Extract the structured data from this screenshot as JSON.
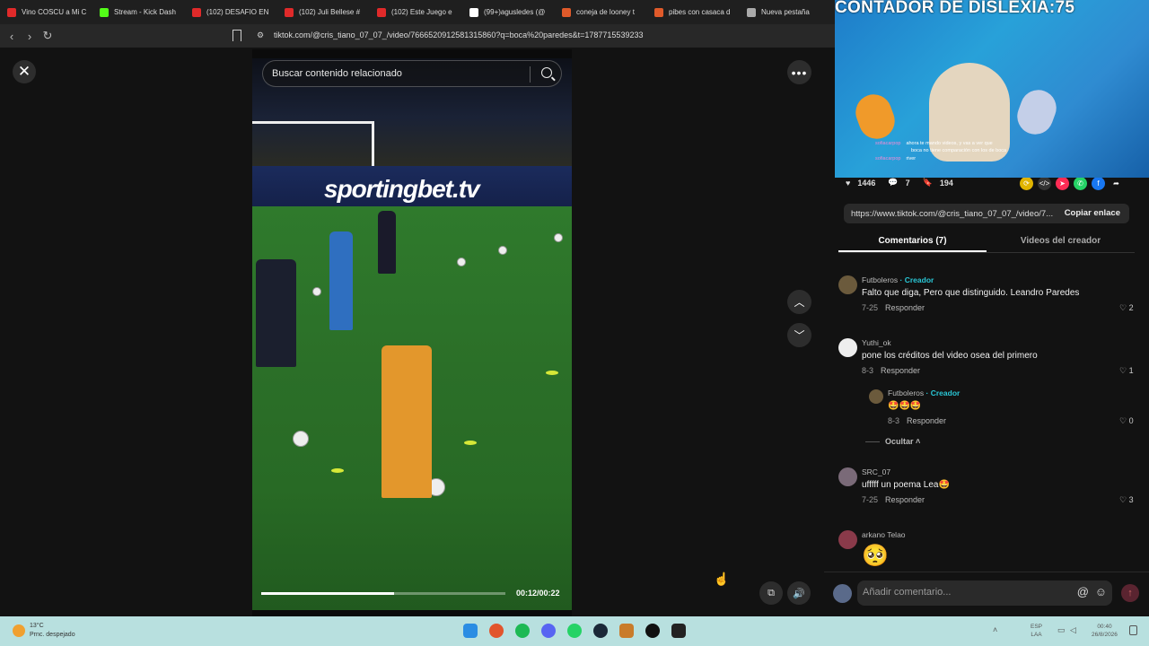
{
  "browser": {
    "tabs": [
      {
        "label": "Vino COSCU a Mi C",
        "color": "#e02a2a"
      },
      {
        "label": "Stream - Kick Dash",
        "color": "#53fc18"
      },
      {
        "label": "(102) DESAFIO EN",
        "color": "#e02a2a"
      },
      {
        "label": "(102) Juli Bellese #",
        "color": "#e02a2a"
      },
      {
        "label": "(102) Este Juego e",
        "color": "#e02a2a"
      },
      {
        "label": "(99+)agusledes (@",
        "color": "#ffffff"
      },
      {
        "label": "coneja de looney t",
        "color": "#e05a2a"
      },
      {
        "label": "pibes con casaca d",
        "color": "#e05a2a"
      },
      {
        "label": "Nueva pestaña",
        "color": "#aaaaaa"
      }
    ],
    "url": "tiktok.com/@cris_tiano_07_07_/video/7666520912581315860?q=boca%20paredes&t=1787715539233"
  },
  "video": {
    "search_placeholder": "Buscar contenido relacionado",
    "ad_text": "sportingbet.tv",
    "time": "00:12/00:22",
    "progress": 0.545
  },
  "stream_overlay": {
    "counter": "CONTADOR DE DISLEXIA:75",
    "chat": [
      {
        "user": "sofiacarpop",
        "text": "ahora te mando videos, y vas a ver que"
      },
      {
        "user": "",
        "text": "boca no tiene comparación con los de boca"
      },
      {
        "user": "sofiacarpop",
        "text": "river"
      }
    ]
  },
  "stats": {
    "likes": "1446",
    "comments": "7",
    "saves": "194"
  },
  "share": {
    "link": "https://www.tiktok.com/@cris_tiano_07_07_/video/7...",
    "copy_label": "Copiar enlace"
  },
  "tabs": {
    "comments": "Comentarios (7)",
    "creator_videos": "Videos del creador"
  },
  "comments": [
    {
      "user": "Futboleros",
      "badge": "· Creador",
      "text": "Falto que diga, Pero que distinguido. Leandro Paredes",
      "date": "7-25",
      "reply": "Responder",
      "likes": "2"
    },
    {
      "user": "Yuthi_ok",
      "badge": "",
      "text": "pone los créditos del video osea del primero",
      "date": "8-3",
      "reply": "Responder",
      "likes": "1"
    },
    {
      "user": "Futboleros",
      "badge": "· Creador",
      "text": "🤩🤩🤩",
      "date": "8-3",
      "reply": "Responder",
      "likes": "0"
    },
    {
      "user": "SRC_07",
      "badge": "",
      "text": "ufffff un poema Lea🤩",
      "date": "7-25",
      "reply": "Responder",
      "likes": "3"
    },
    {
      "user": "arkano Telao",
      "badge": "",
      "text": "🥺",
      "date": "",
      "reply": "",
      "likes": ""
    }
  ],
  "hide_replies": "Ocultar",
  "comment_input_placeholder": "Añadir comentario...",
  "taskbar": {
    "weather_temp": "13°C",
    "weather_desc": "Prnc. despejado",
    "lang": "ESP",
    "lang2": "LAA",
    "time": "00:40",
    "date": "26/8/2026"
  }
}
